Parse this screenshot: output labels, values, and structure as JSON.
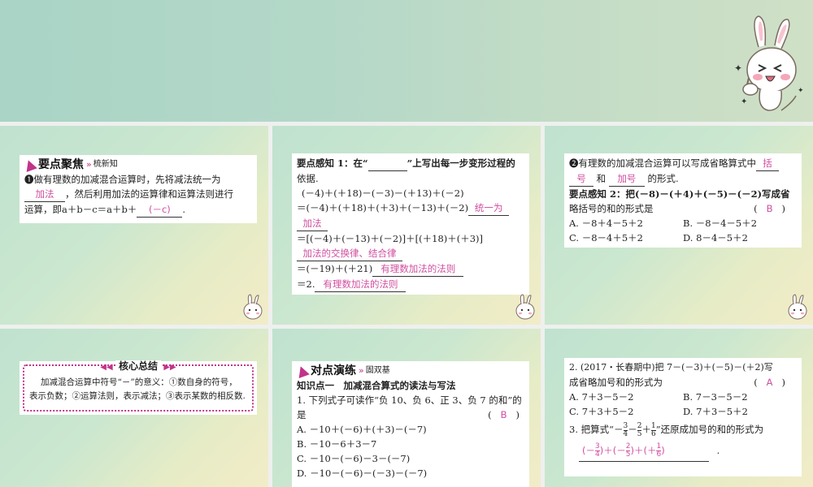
{
  "top": {
    "decor": "bunny-thumbs-up"
  },
  "s1": {
    "header": {
      "title": "要点聚焦",
      "sub": "梳新知"
    },
    "q1_num": "❶",
    "q1_a": "做有理数的加减混合运算时，先将减法统一为",
    "q1_blank1": "加法",
    "q1_b": "，然后利用加法的运算律和运算法则进行",
    "q1_c": "运算，即a＋b－c＝a＋b＋",
    "q1_blank2": "(－c)",
    "q1_end": "."
  },
  "s2": {
    "l1": "要点感知 1：在“",
    "l1b": "”上写出每一步变形过程的",
    "l2": "依据.",
    "l3": "(－4)＋(＋18)－(－3)－(＋13)＋(－2)",
    "l4": "＝(－4)＋(＋18)＋(＋3)＋(－13)＋(－2)",
    "a1": "统一为",
    "a1b": "加法",
    "l5": "＝[(－4)＋(－13)＋(－2)]＋[(＋18)＋(＋3)]",
    "a2": "加法的交换律、结合律",
    "l6": "＝(－19)＋(＋21)",
    "a3": "有理数加法的法则",
    "l7": "＝2.",
    "a4": "有理数加法的法则"
  },
  "s3": {
    "q2_num": "❷",
    "q2_a": "有理数的加减混合运算可以写成省略算式中",
    "q2_blank1a": "括",
    "q2_blank1b": "号",
    "q2_and": "和",
    "q2_blank2": "加号",
    "q2_end": "的形式.",
    "p2_a": "要点感知 2：把(－8)－(＋4)＋(－5)－(－2)写成省",
    "p2_b": "略括号的和的形式是",
    "p2_paren_l": "(",
    "p2_answer": "B",
    "p2_paren_r": ")",
    "choices": [
      "A. －8＋4－5＋2",
      "B. －8－4－5＋2",
      "C. －8－4＋5＋2",
      "D. 8－4－5＋2"
    ]
  },
  "s4": {
    "title": "核心总结",
    "text_a": "加减混合运算中符号“－”的意义：①数自身的符号，",
    "text_b": "表示负数；②运算法则，表示减法；③表示某数的相反数."
  },
  "s5": {
    "header": {
      "title": "对点演练",
      "sub": "固双基"
    },
    "section": "知识点一　加减混合算式的读法与写法",
    "q1a": "1. 下列式子可读作“负 10、负 6、正 3、负 7 的和”的",
    "q1b": "是",
    "q1_paren_l": "(",
    "q1_answer": "B",
    "q1_paren_r": ")",
    "choices": [
      "A. －10＋(－6)＋(＋3)－(－7)",
      "B. －10－6＋3－7",
      "C. －10－(－6)－3－(－7)",
      "D. －10－(－6)－(－3)－(－7)"
    ]
  },
  "s6": {
    "q2a": "2. (2017・长春期中)把 7－(－3)＋(－5)－(＋2)写",
    "q2b": "成省略加号和的形式为",
    "q2_paren_l": "(",
    "q2_answer": "A",
    "q2_paren_r": ")",
    "choices": [
      "A. 7＋3－5－2",
      "B. 7－3－5－2",
      "C. 7＋3＋5－2",
      "D. 7＋3－5＋2"
    ],
    "q3a": "3. 把算式“－",
    "q3_f1": {
      "n": "3",
      "d": "4"
    },
    "q3_op1": "－",
    "q3_f2": {
      "n": "2",
      "d": "5"
    },
    "q3_op2": "＋",
    "q3_f3": {
      "n": "1",
      "d": "6"
    },
    "q3b": "”还原成加号的和的形式为",
    "ans_open1": "(－",
    "ans_close": ")",
    "ans_plus": "＋",
    "ans_open2": "(－",
    "ans_open3": "(＋",
    "q3_end": "."
  }
}
